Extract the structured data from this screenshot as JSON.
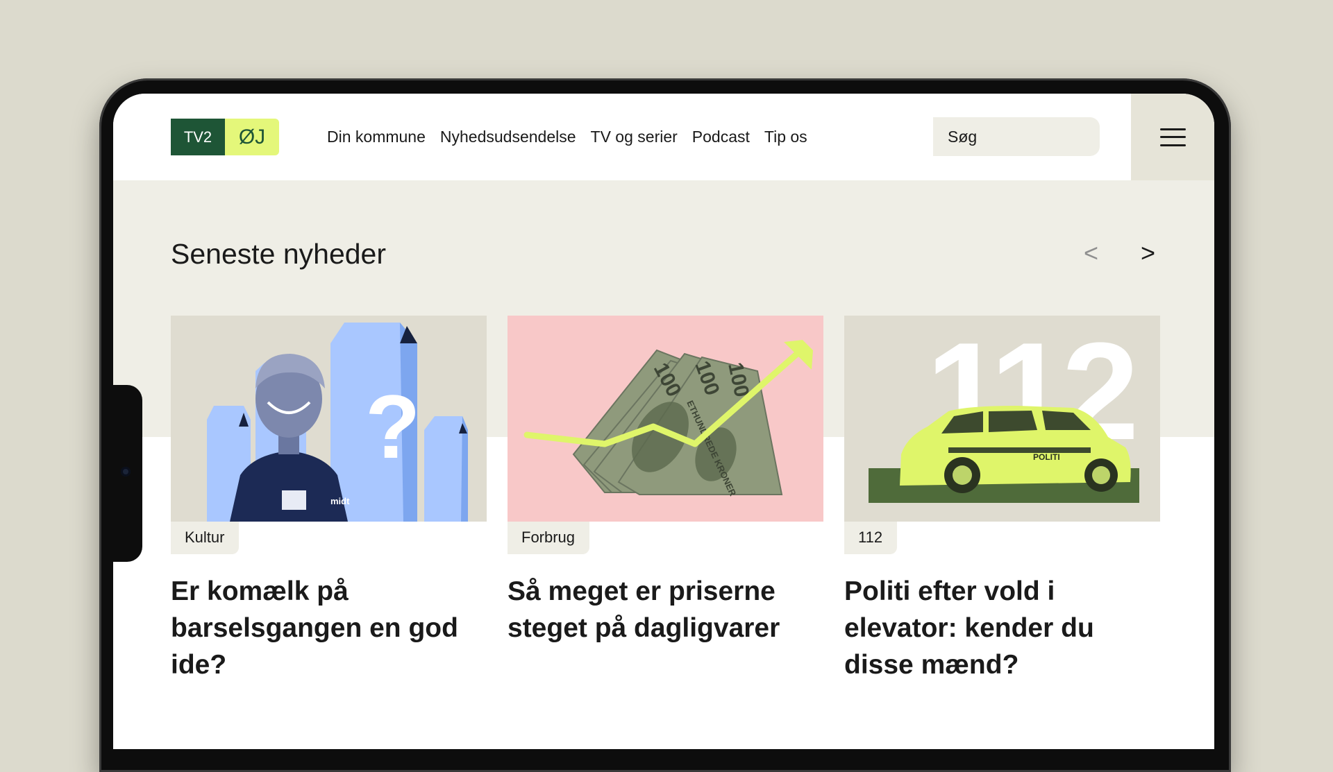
{
  "header": {
    "logo": {
      "part1": "TV2",
      "part2": "ØJ"
    },
    "nav": [
      "Din kommune",
      "Nyhedsudsendelse",
      "TV og serier",
      "Podcast",
      "Tip os"
    ],
    "search_placeholder": "Søg",
    "menu_icon": "hamburger-menu-icon"
  },
  "section": {
    "title": "Seneste nyheder",
    "prev_arrow": "<",
    "next_arrow": ">"
  },
  "cards": [
    {
      "tag": "Kultur",
      "title": "Er komælk på barselsgangen en god ide?",
      "image": {
        "question_mark": "?",
        "logo_text": "midt"
      }
    },
    {
      "tag": "Forbrug",
      "title": "Så meget er priserne steget på dagligvarer",
      "image": {
        "banknote_value": "100",
        "banknote_text": "ETHUNDREDE KRONER"
      }
    },
    {
      "tag": "112",
      "title": "Politi efter vold i elevator: kender du disse mænd?",
      "image": {
        "big_number": "112",
        "car_text": "POLITI"
      }
    }
  ],
  "colors": {
    "brand_green": "#1e5536",
    "brand_lime": "#e4f77a",
    "band_background": "#efeee6",
    "card1_blue": "#a9c7ff",
    "card2_pink": "#f8c8c8",
    "card3_lime": "#dff56a"
  }
}
